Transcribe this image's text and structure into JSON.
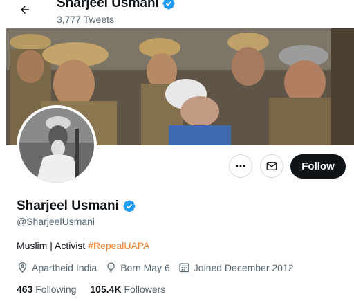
{
  "header": {
    "name": "Sharjeel Usmani",
    "tweet_count": "3,777 Tweets"
  },
  "actions": {
    "more_icon": "more-icon",
    "message_icon": "mail-icon",
    "follow_label": "Follow"
  },
  "profile": {
    "display_name": "Sharjeel Usmani",
    "verified": true,
    "handle": "@SharjeelUsmani",
    "bio_text": "Muslim | Activist ",
    "bio_hashtag": "#RepealUAPA",
    "location": "Apartheid India",
    "birthday": "Born May 6",
    "joined": "Joined December 2012"
  },
  "stats": {
    "following_count": "463",
    "following_label": "Following",
    "followers_count": "105.4K",
    "followers_label": "Followers"
  },
  "colors": {
    "verified_blue": "#1d9bf0",
    "hashtag_orange": "#f4802a",
    "secondary_text": "#536471",
    "follow_button_bg": "#0f1419"
  }
}
